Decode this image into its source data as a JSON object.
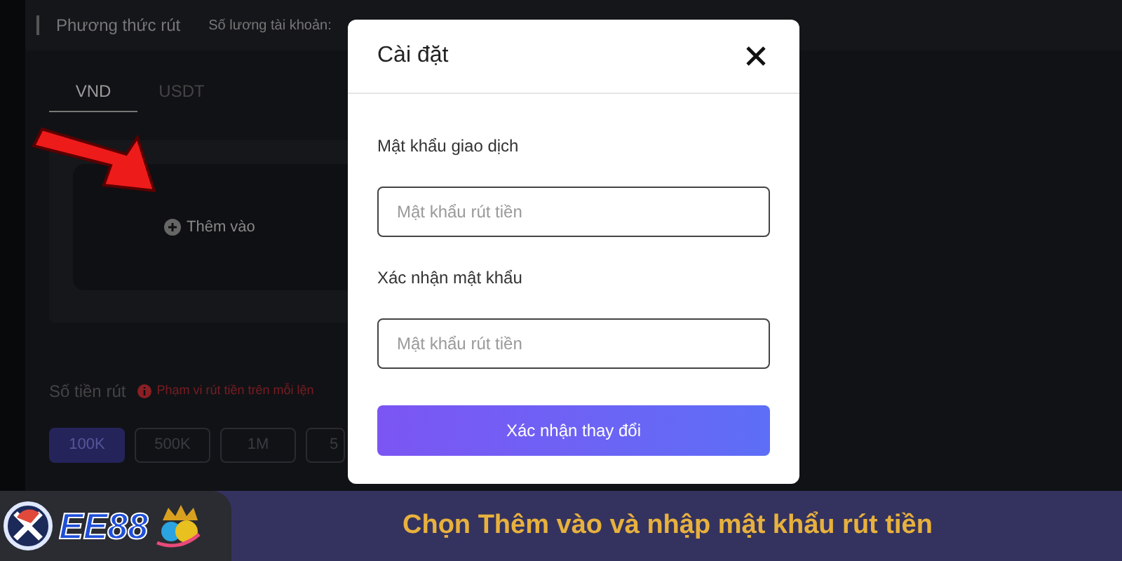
{
  "header": {
    "title": "Phương thức rút",
    "account_count_label": "Số lương tài khoản:"
  },
  "tabs": [
    {
      "label": "VND",
      "selected": true
    },
    {
      "label": "USDT",
      "selected": false
    }
  ],
  "add_card": {
    "label": "Thêm vào"
  },
  "amount": {
    "label": "Số tiền rút",
    "notice": "Phạm vi rút tiền trên mỗi lện",
    "options": [
      {
        "label": "100K",
        "selected": true
      },
      {
        "label": "500K",
        "selected": false
      },
      {
        "label": "1M",
        "selected": false
      },
      {
        "label": "5",
        "selected": false
      }
    ]
  },
  "dialog": {
    "title": "Cài đặt",
    "fields": [
      {
        "label": "Mật khẩu giao dịch",
        "placeholder": "Mật khẩu rút tiền"
      },
      {
        "label": "Xác nhận mật khẩu",
        "placeholder": "Mật khẩu rút tiền"
      }
    ],
    "submit": "Xác nhận thay đổi"
  },
  "banner": {
    "logo_text": "EE88",
    "caption": "Chọn Thêm vào và nhập mật khẩu rút tiền"
  }
}
